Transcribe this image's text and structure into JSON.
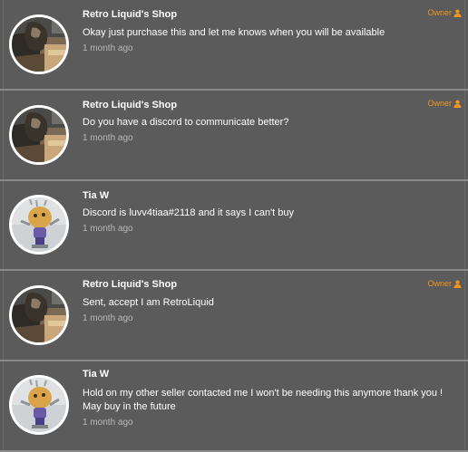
{
  "comments": [
    {
      "author": "Retro Liquid's Shop",
      "message": "Okay just purchase this and let me knows when you will be available",
      "time": "1 month ago",
      "badge": "Owner",
      "avatar": "shop-cat-avatar"
    },
    {
      "author": "Retro Liquid's Shop",
      "message": "Do you have a discord to communicate better?",
      "time": "1 month ago",
      "badge": "Owner",
      "avatar": "shop-cat-avatar"
    },
    {
      "author": "Tia W",
      "message": "Discord is luvv4tiaa#2118 and it says I can't buy",
      "time": "1 month ago",
      "badge": "",
      "avatar": "figurine-avatar"
    },
    {
      "author": "Retro Liquid's Shop",
      "message": "Sent, accept I am RetroLiquid",
      "time": "1 month ago",
      "badge": "Owner",
      "avatar": "shop-cat-avatar"
    },
    {
      "author": "Tia W",
      "message": "Hold on my other seller contacted me I won't be needing this anymore thank you ! May buy in the future",
      "time": "1 month ago",
      "badge": "",
      "avatar": "figurine-avatar"
    }
  ],
  "colors": {
    "background": "#5a5a5a",
    "owner_badge": "#f0961e",
    "text": "#ffffff",
    "muted": "#b8b8b8"
  }
}
